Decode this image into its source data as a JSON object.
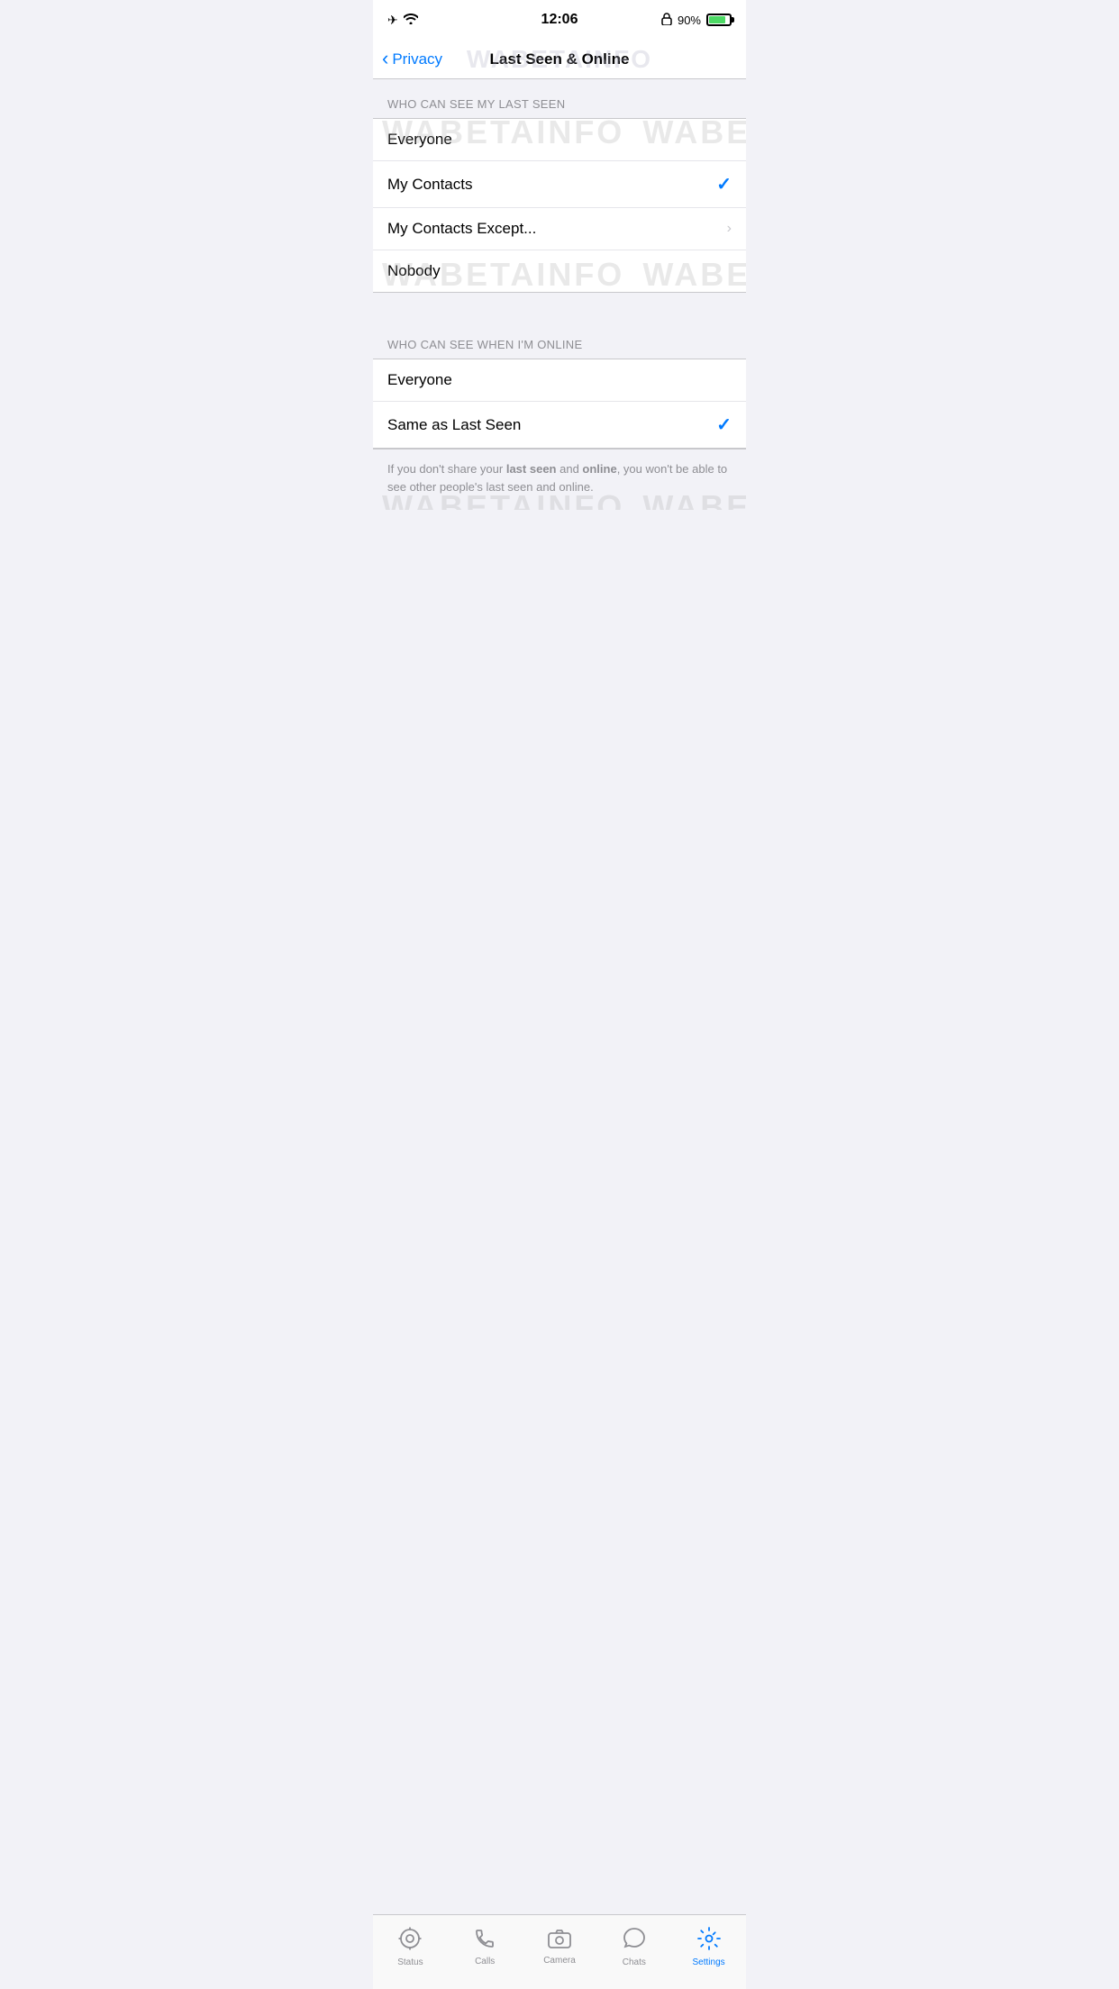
{
  "statusBar": {
    "time": "12:06",
    "battery": "90%"
  },
  "navBar": {
    "backLabel": "Privacy",
    "title": "Last Seen & Online"
  },
  "watermark": "WABetaInfo",
  "sections": [
    {
      "id": "last-seen",
      "header": "WHO CAN SEE MY LAST SEEN",
      "items": [
        {
          "id": "everyone-ls",
          "label": "Everyone",
          "selected": false,
          "hasChevron": false
        },
        {
          "id": "my-contacts-ls",
          "label": "My Contacts",
          "selected": true,
          "hasChevron": false
        },
        {
          "id": "my-contacts-except-ls",
          "label": "My Contacts Except...",
          "selected": false,
          "hasChevron": true
        },
        {
          "id": "nobody-ls",
          "label": "Nobody",
          "selected": false,
          "hasChevron": false
        }
      ]
    },
    {
      "id": "online",
      "header": "WHO CAN SEE WHEN I'M ONLINE",
      "items": [
        {
          "id": "everyone-ol",
          "label": "Everyone",
          "selected": false,
          "hasChevron": false
        },
        {
          "id": "same-as-last-seen-ol",
          "label": "Same as Last Seen",
          "selected": true,
          "hasChevron": false
        }
      ]
    }
  ],
  "infoText": {
    "text": "If you don't share your last seen and online, you won't be able to see other people's last seen and online.",
    "boldWords": [
      "last seen",
      "online"
    ]
  },
  "tabBar": {
    "items": [
      {
        "id": "status",
        "label": "Status",
        "icon": "status",
        "active": false
      },
      {
        "id": "calls",
        "label": "Calls",
        "icon": "calls",
        "active": false
      },
      {
        "id": "camera",
        "label": "Camera",
        "icon": "camera",
        "active": false
      },
      {
        "id": "chats",
        "label": "Chats",
        "icon": "chats",
        "active": false
      },
      {
        "id": "settings",
        "label": "Settings",
        "icon": "settings",
        "active": true
      }
    ]
  }
}
